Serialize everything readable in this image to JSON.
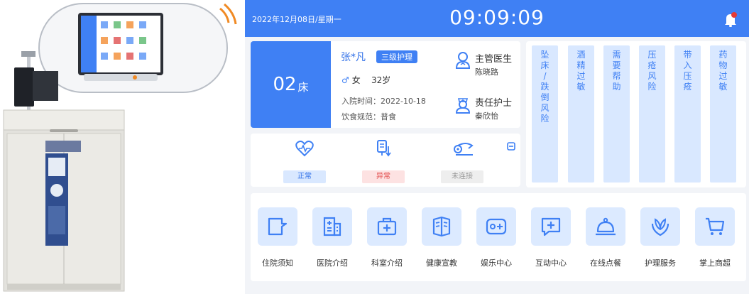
{
  "colors": {
    "accent": "#3f80f4",
    "alert_bg": "#d9e8ff",
    "abnormal": "#e24a4a"
  },
  "topbar": {
    "date": "2022年12月08日/星期一",
    "time": "09:09:09"
  },
  "patient": {
    "bed_number": "02",
    "bed_unit": "床",
    "name": "张*凡",
    "care_level": "三级护理",
    "gender": "女",
    "age": "32岁",
    "admit_label": "入院时间：",
    "admit_date": "2022-10-18",
    "diet_label": "饮食规范：",
    "diet": "普食",
    "doctor_role": "主管医生",
    "doctor_name": "陈晓路",
    "nurse_role": "责任护士",
    "nurse_name": "秦欣怡"
  },
  "vitals": [
    {
      "icon": "heart-rate-icon",
      "status": "正常"
    },
    {
      "icon": "infusion-icon",
      "status": "异常"
    },
    {
      "icon": "pump-icon",
      "status": "未连接"
    }
  ],
  "alerts": [
    "坠床/跌倒风险",
    "酒精过敏",
    "需要帮助",
    "压疮风险",
    "带入压疮",
    "药物过敏"
  ],
  "apps": [
    {
      "icon": "notice-icon",
      "label": "住院须知"
    },
    {
      "icon": "hospital-icon",
      "label": "医院介绍"
    },
    {
      "icon": "medical-kit-icon",
      "label": "科室介绍"
    },
    {
      "icon": "book-icon",
      "label": "健康宣教"
    },
    {
      "icon": "gamepad-icon",
      "label": "娱乐中心"
    },
    {
      "icon": "chat-plus-icon",
      "label": "互动中心"
    },
    {
      "icon": "cloche-icon",
      "label": "在线点餐"
    },
    {
      "icon": "care-plant-icon",
      "label": "护理服务"
    },
    {
      "icon": "cart-icon",
      "label": "掌上商超"
    }
  ]
}
